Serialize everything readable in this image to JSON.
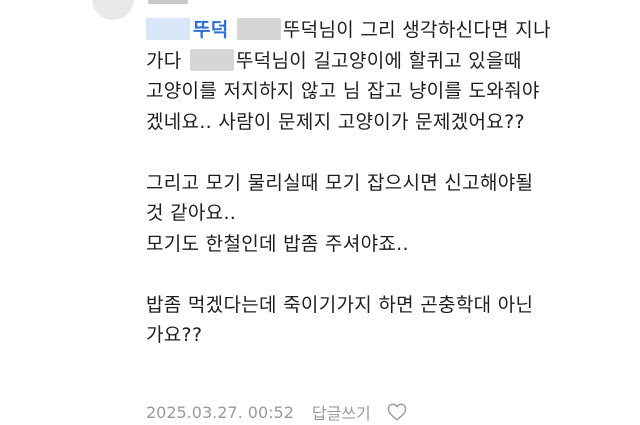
{
  "comment": {
    "mention": "뚜덕",
    "lines": [
      {
        "pre": "",
        "post": "뚜덕님이 그리 생각하신다면 지나"
      },
      {
        "pre": "가다",
        "post": "뚜덕님이 길고양이에 할퀴고 있을때"
      },
      {
        "text": "고양이를 저지하지 않고 님 잡고 냥이를 도와줘야"
      },
      {
        "text": "겠네요.. 사람이 문제지 고양이가 문제겠어요??"
      },
      {
        "text": "그리고 모기 물리실때 모기 잡으시면 신고해야될"
      },
      {
        "text": "것 같아요.."
      },
      {
        "text": "모기도 한철인데 밥좀 주셔야죠.."
      },
      {
        "text": "밥좀 먹겠다는데 죽이기가지 하면 곤충학대 아닌"
      },
      {
        "text": "가요??"
      }
    ]
  },
  "footer": {
    "timestamp": "2025.03.27. 00:52",
    "reply_label": "답글쓰기",
    "like_icon": "heart-outline-icon"
  }
}
